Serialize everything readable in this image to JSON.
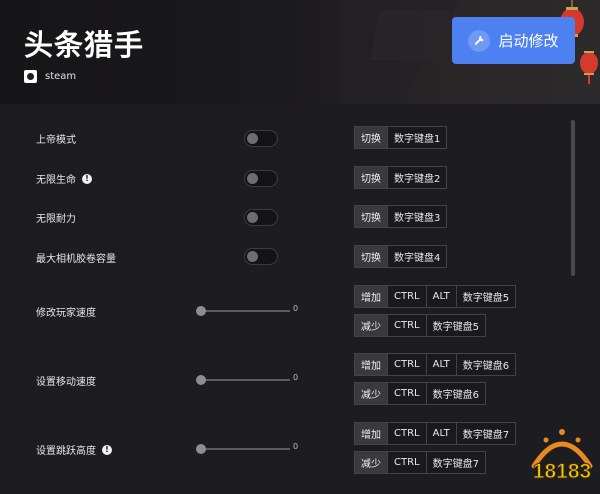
{
  "header": {
    "title": "头条猎手",
    "platform": "steam",
    "launch_label": "启动修改",
    "watermark": "18183"
  },
  "cheats": [
    {
      "label": "上帝模式",
      "control": "toggle",
      "info": false,
      "hotkeys": [
        {
          "mode": "切换",
          "keys": [
            "数字键盘1"
          ]
        }
      ]
    },
    {
      "label": "无限生命",
      "control": "toggle",
      "info": true,
      "hotkeys": [
        {
          "mode": "切换",
          "keys": [
            "数字键盘2"
          ]
        }
      ]
    },
    {
      "label": "无限耐力",
      "control": "toggle",
      "info": false,
      "hotkeys": [
        {
          "mode": "切换",
          "keys": [
            "数字键盘3"
          ]
        }
      ]
    },
    {
      "label": "最大相机胶卷容量",
      "control": "toggle",
      "info": false,
      "hotkeys": [
        {
          "mode": "切换",
          "keys": [
            "数字键盘4"
          ]
        }
      ]
    },
    {
      "label": "修改玩家速度",
      "control": "slider",
      "value": "0",
      "info": false,
      "hotkeys": [
        {
          "mode": "增加",
          "keys": [
            "CTRL",
            "ALT",
            "数字键盘5"
          ]
        },
        {
          "mode": "减少",
          "keys": [
            "CTRL",
            "数字键盘5"
          ]
        }
      ]
    },
    {
      "label": "设置移动速度",
      "control": "slider",
      "value": "0",
      "info": false,
      "hotkeys": [
        {
          "mode": "增加",
          "keys": [
            "CTRL",
            "ALT",
            "数字键盘6"
          ]
        },
        {
          "mode": "减少",
          "keys": [
            "CTRL",
            "数字键盘6"
          ]
        }
      ]
    },
    {
      "label": "设置跳跃高度",
      "control": "slider",
      "value": "0",
      "info": true,
      "hotkeys": [
        {
          "mode": "增加",
          "keys": [
            "CTRL",
            "ALT",
            "数字键盘7"
          ]
        },
        {
          "mode": "减少",
          "keys": [
            "CTRL",
            "数字键盘7"
          ]
        }
      ]
    }
  ],
  "colors": {
    "accent": "#4d80f0",
    "background": "#1d1c20",
    "lantern": "#d63a2c"
  },
  "icons": {
    "platform": "steam-icon",
    "launch": "wrench-icon",
    "info": "info-icon"
  }
}
